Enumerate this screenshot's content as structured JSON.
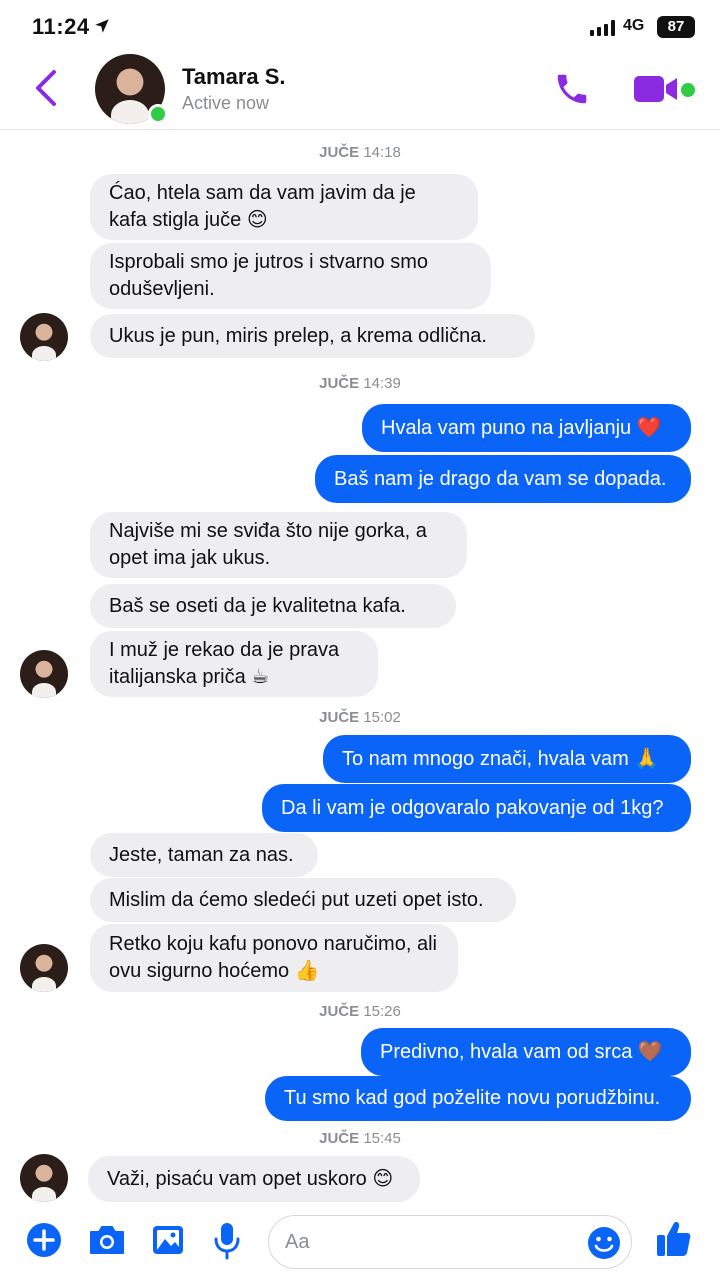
{
  "status_bar": {
    "time": "11:24",
    "network": "4G",
    "battery": "87"
  },
  "header": {
    "name": "Tamara S.",
    "status": "Active now"
  },
  "timestamps": [
    {
      "day": "JUČE",
      "time": "14:18"
    },
    {
      "day": "JUČE",
      "time": "14:39"
    },
    {
      "day": "JUČE",
      "time": "15:02"
    },
    {
      "day": "JUČE",
      "time": "15:26"
    },
    {
      "day": "JUČE",
      "time": "15:45"
    }
  ],
  "messages": [
    {
      "dir": "in",
      "text": "Ćao, htela sam da vam javim da je kafa stigla juče 😊"
    },
    {
      "dir": "in",
      "text": "Isprobali smo je jutros i stvarno smo oduševljeni."
    },
    {
      "dir": "in",
      "text": "Ukus je pun, miris prelep, a krema odlična."
    },
    {
      "dir": "out",
      "text": "Hvala vam puno na javljanju ❤️"
    },
    {
      "dir": "out",
      "text": "Baš nam je drago da vam se dopada."
    },
    {
      "dir": "in",
      "text": "Najviše mi se sviđa što nije gorka, a opet ima jak ukus."
    },
    {
      "dir": "in",
      "text": "Baš se oseti da je kvalitetna kafa."
    },
    {
      "dir": "in",
      "text": "I muž je rekao da je prava italijanska priča ☕"
    },
    {
      "dir": "out",
      "text": "To nam mnogo znači, hvala vam 🙏"
    },
    {
      "dir": "out",
      "text": "Da li vam je odgovaralo pakovanje od 1kg?"
    },
    {
      "dir": "in",
      "text": "Jeste, taman za nas."
    },
    {
      "dir": "in",
      "text": "Mislim da ćemo sledeći put uzeti opet isto."
    },
    {
      "dir": "in",
      "text": "Retko koju kafu ponovo naručimo, ali ovu sigurno hoćemo 👍"
    },
    {
      "dir": "out",
      "text": "Predivno, hvala vam od srca 🤎"
    },
    {
      "dir": "out",
      "text": "Tu smo kad god poželite novu porudžbinu."
    },
    {
      "dir": "in",
      "text": "Važi, pisaću vam opet uskoro 😊"
    }
  ],
  "composer": {
    "placeholder": "Aa"
  },
  "icons": {
    "back": "chevron-left-icon",
    "call": "phone-icon",
    "video": "video-camera-icon",
    "add": "plus-icon",
    "camera": "camera-icon",
    "gallery": "image-icon",
    "mic": "microphone-icon",
    "emoji": "smiley-icon",
    "like": "thumbs-up-icon"
  },
  "colors": {
    "accent_header": "#8a2be2",
    "accent_blue": "#0a64f7",
    "online": "#31cc46",
    "incoming_bubble": "#eeeef0",
    "meta_gray": "#8a8d91"
  }
}
